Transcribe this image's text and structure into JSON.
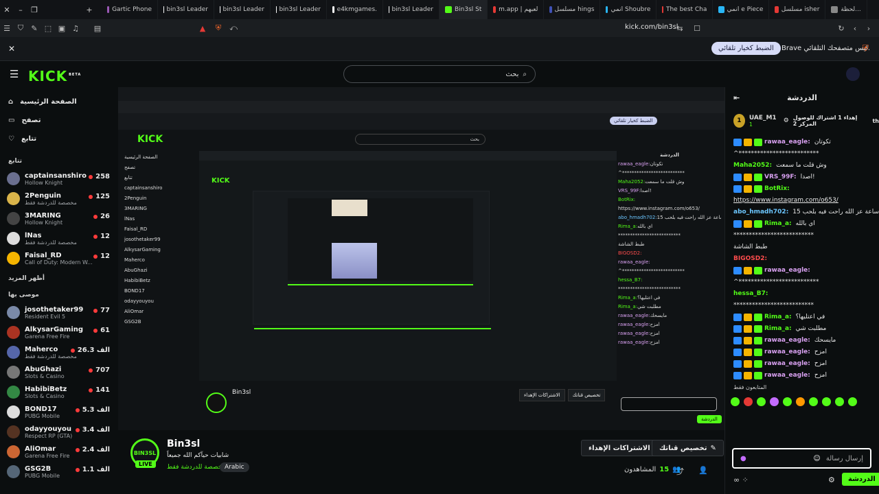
{
  "browser": {
    "tabs": [
      {
        "label": "Gartic Phone",
        "color": "#9b59b6"
      },
      {
        "label": "bin3sl Leader",
        "color": "#ffffff"
      },
      {
        "label": "bin3sl Leader",
        "color": "#ffffff"
      },
      {
        "label": "bin3sl Leader",
        "color": "#ffffff"
      },
      {
        "label": "e4kmgames.",
        "color": "#ffffff"
      },
      {
        "label": "bin3sl Leader",
        "color": "#ffffff"
      },
      {
        "label": "Bin3sl St",
        "color": "#53fc18"
      },
      {
        "label": "m.app | لعبهم",
        "color": "#e53935"
      },
      {
        "label": "مسلسل hings",
        "color": "#3f51b5"
      },
      {
        "label": "انمي Shoubre",
        "color": "#29b6f6"
      },
      {
        "label": "The best Cha",
        "color": "#e53935"
      },
      {
        "label": "انمي e Piece",
        "color": "#29b6f6"
      },
      {
        "label": "مسلسل isher",
        "color": "#e53935"
      },
      {
        "label": "لحظة...",
        "color": "#888888"
      }
    ],
    "url": "kick.com/bin3sl",
    "infobar_text": "Brave ليس متصفحك التلقائي.",
    "infobar_button": "الضبط كخيار تلقائي"
  },
  "nav": {
    "logo": "KICK",
    "logo_beta": "BETA",
    "search_placeholder": "بحث",
    "items": [
      {
        "label": "الصفحة الرئيسية"
      },
      {
        "label": "تصفح"
      },
      {
        "label": "تتابع"
      }
    ],
    "following_title": "تتابع",
    "show_more": "أظهر المزيد",
    "recommended_title": "موصى بها"
  },
  "following": [
    {
      "name": "captainsanshiro",
      "game": "Hollow Knight",
      "viewers": "258",
      "color": "#6a6f8f"
    },
    {
      "name": "2Penguin",
      "game": "مخصصة للدردشة فقط",
      "viewers": "125",
      "color": "#d9b44a"
    },
    {
      "name": "3MARING",
      "game": "Hollow Knight",
      "viewers": "26",
      "color": "#444444"
    },
    {
      "name": "lNas",
      "game": "مخصصة للدردشة فقط",
      "viewers": "12",
      "color": "#dddddd"
    },
    {
      "name": "Faisal_RD",
      "game": "Call of Duty: Modern W...",
      "viewers": "12",
      "color": "#f4b400"
    }
  ],
  "recommended": [
    {
      "name": "josothetaker99",
      "game": "Resident Evil 5",
      "viewers": "77",
      "color": "#7a8aa8"
    },
    {
      "name": "AlkysarGaming",
      "game": "Garena Free Fire",
      "viewers": "61",
      "color": "#aa3322"
    },
    {
      "name": "Maherco",
      "game": "مخصصة للدردشة فقط",
      "viewers": "الف 26.3",
      "color": "#5566aa"
    },
    {
      "name": "AbuGhazi",
      "game": "Slots & Casino",
      "viewers": "707",
      "color": "#777777"
    },
    {
      "name": "HabibiBetz",
      "game": "Slots & Casino",
      "viewers": "141",
      "color": "#338844"
    },
    {
      "name": "BOND17",
      "game": "PUBG Mobile",
      "viewers": "الف 5.3",
      "color": "#dddddd"
    },
    {
      "name": "odayyouyou",
      "game": "Respect RP (GTA)",
      "viewers": "الف 3.4",
      "color": "#553322"
    },
    {
      "name": "AliOmar",
      "game": "Garena Free Fire",
      "viewers": "الف 2.4",
      "color": "#cc6633"
    },
    {
      "name": "GSG2B",
      "game": "PUBG Mobile",
      "viewers": "الف 1.1",
      "color": "#556677"
    }
  ],
  "stream": {
    "streamer": "Bin3sl",
    "avatar_text": "BIN3SL",
    "live": "LIVE",
    "title": "شابيات حيآكم الله جميعاً",
    "category": "مخصصة للدردشة فقط",
    "language": "Arabic",
    "customize_button": "تخصيص قناتك",
    "subscribe_button": "الاشتراكات الإهداء",
    "viewers_label": "المشاهدون",
    "viewers_count": "15"
  },
  "chat": {
    "title": "الدردشة",
    "pinned_user": "UAE_M1",
    "pinned_count": "1",
    "pinned_text": "إهداء 1 اشتراك للوصول المركز 2",
    "pinned_suffix": "th",
    "messages": [
      {
        "user": "rawaa_eagle:",
        "text": "تكوتان",
        "color": "#d8a0f0",
        "badges": true
      },
      {
        "user": "",
        "text": "^**************************",
        "color": "#ffffff",
        "badges": false
      },
      {
        "user": "Maha2052:",
        "text": "وش قلت ما سمعت",
        "color": "#53fc18",
        "badges": false
      },
      {
        "user": "VRS_99F:",
        "text": "اصدا!",
        "color": "#d8a0f0",
        "badges": true
      },
      {
        "user": "BotRix:",
        "text": "",
        "color": "#53fc18",
        "badges": true
      },
      {
        "user": "",
        "text": "https://www.instagram.com/o653/",
        "color": "#ffffff",
        "badges": false
      },
      {
        "user": "abo_hmadh702:",
        "text": "ساعة عز الله راحت فيه بلحب 15",
        "color": "#6cc6ff",
        "badges": false
      },
      {
        "user": "Rima_a:",
        "text": "اي بالله",
        "color": "#53fc18",
        "badges": true
      },
      {
        "user": "",
        "text": "**************************",
        "color": "#ffffff",
        "badges": false
      },
      {
        "user": "",
        "text": "طبط الشاشة",
        "color": "#ffffff",
        "badges": false
      },
      {
        "user": "BIGOSD2:",
        "text": "",
        "color": "#ff4d4d",
        "badges": false
      },
      {
        "user": "rawaa_eagle:",
        "text": "",
        "color": "#d8a0f0",
        "badges": true
      },
      {
        "user": "",
        "text": "^**************************",
        "color": "#ffffff",
        "badges": false
      },
      {
        "user": "hessa_B7:",
        "text": "",
        "color": "#53fc18",
        "badges": false
      },
      {
        "user": "",
        "text": "**************************",
        "color": "#ffffff",
        "badges": false
      },
      {
        "user": "Rima_a:",
        "text": "في اعتليها؟",
        "color": "#53fc18",
        "badges": true
      },
      {
        "user": "Rima_a:",
        "text": "مطلبت شي",
        "color": "#53fc18",
        "badges": true
      },
      {
        "user": "rawaa_eagle:",
        "text": "مايسحك",
        "color": "#d8a0f0",
        "badges": true
      },
      {
        "user": "rawaa_eagle:",
        "text": "امزح",
        "color": "#d8a0f0",
        "badges": true
      },
      {
        "user": "rawaa_eagle:",
        "text": "امزح",
        "color": "#d8a0f0",
        "badges": true
      },
      {
        "user": "rawaa_eagle:",
        "text": "امزح",
        "color": "#d8a0f0",
        "badges": true
      }
    ],
    "emote_label": "المتابعون فقط",
    "input_placeholder": "إرسال رسالة",
    "send_button": "الدردشة"
  }
}
